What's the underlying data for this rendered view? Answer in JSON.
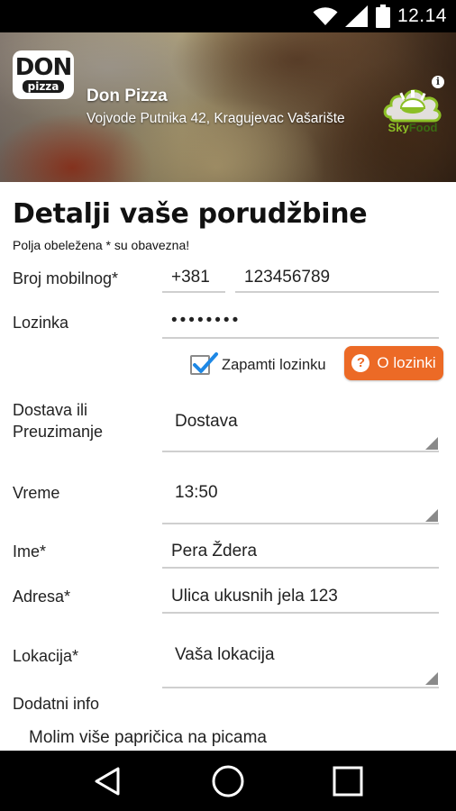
{
  "status_bar": {
    "time": "12.14",
    "icons": [
      "wifi-icon",
      "signal-icon",
      "battery-icon"
    ]
  },
  "header": {
    "logo_text_top": "DON",
    "logo_text_bottom": "pizza",
    "restaurant_name": "Don Pizza",
    "restaurant_address": "Vojvode Putnika 42, Kragujevac Vašarište",
    "skyfood_brand": "SkyFood",
    "skyfood_brand_sky": "Sky",
    "skyfood_brand_food": "Food",
    "info_icon_glyph": "i"
  },
  "form": {
    "title": "Detalji vaše porudžbine",
    "required_note": "Polja obeležena * su obavezna!",
    "phone": {
      "label": "Broj mobilnog*",
      "country_code": "+381",
      "number": "123456789"
    },
    "password": {
      "label": "Lozinka",
      "value": "••••••••"
    },
    "remember": {
      "label": "Zapamti lozinku",
      "checked": true
    },
    "password_info_button": {
      "label": "O lozinki",
      "icon_glyph": "?"
    },
    "delivery": {
      "label_line1": "Dostava ili",
      "label_line2": "Preuzimanje",
      "value": "Dostava"
    },
    "time": {
      "label": "Vreme",
      "value": "13:50"
    },
    "name": {
      "label": "Ime*",
      "value": "Pera Ždera"
    },
    "address": {
      "label": "Adresa*",
      "value": "Ulica ukusnih jela 123"
    },
    "location": {
      "label": "Lokacija*",
      "value": "Vaša lokacija"
    },
    "extra_info": {
      "label": "Dodatni info",
      "value": "Molim više papričica na picama"
    }
  },
  "nav_bar": {
    "buttons": [
      "back-icon",
      "home-icon",
      "recents-icon"
    ]
  },
  "colors": {
    "accent": "#ec6a26",
    "checkbox": "#1e88e5",
    "skyfood_green": "#8cbf26"
  }
}
